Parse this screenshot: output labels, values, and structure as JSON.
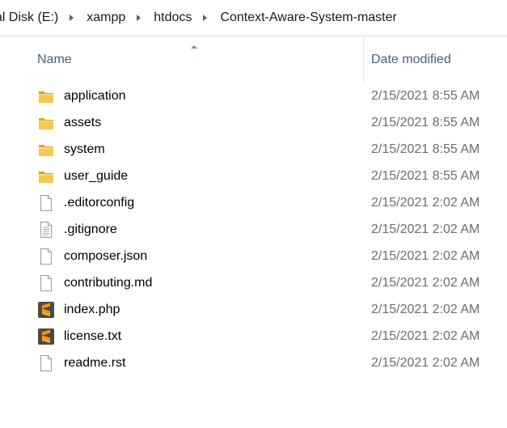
{
  "breadcrumb": {
    "items": [
      "al Disk (E:)",
      "xampp",
      "htdocs",
      "Context-Aware-System-master"
    ]
  },
  "columns": {
    "name": "Name",
    "date_modified": "Date modified",
    "sort": "ascending"
  },
  "files": [
    {
      "name": "application",
      "date": "2/15/2021 8:55 AM",
      "icon": "folder-icon"
    },
    {
      "name": "assets",
      "date": "2/15/2021 8:55 AM",
      "icon": "folder-icon"
    },
    {
      "name": "system",
      "date": "2/15/2021 8:55 AM",
      "icon": "folder-icon"
    },
    {
      "name": "user_guide",
      "date": "2/15/2021 8:55 AM",
      "icon": "folder-icon"
    },
    {
      "name": ".editorconfig",
      "date": "2/15/2021 2:02 AM",
      "icon": "file-icon"
    },
    {
      "name": ".gitignore",
      "date": "2/15/2021 2:02 AM",
      "icon": "text-file-icon"
    },
    {
      "name": "composer.json",
      "date": "2/15/2021 2:02 AM",
      "icon": "file-icon"
    },
    {
      "name": "contributing.md",
      "date": "2/15/2021 2:02 AM",
      "icon": "file-icon"
    },
    {
      "name": "index.php",
      "date": "2/15/2021 2:02 AM",
      "icon": "sublime-text-icon"
    },
    {
      "name": "license.txt",
      "date": "2/15/2021 2:02 AM",
      "icon": "sublime-text-icon"
    },
    {
      "name": "readme.rst",
      "date": "2/15/2021 2:02 AM",
      "icon": "file-icon"
    }
  ],
  "colors": {
    "header_text": "#4c607a",
    "date_text": "#6d6d6d",
    "folder": "#e8b53b",
    "sublime": "#ff9800"
  }
}
